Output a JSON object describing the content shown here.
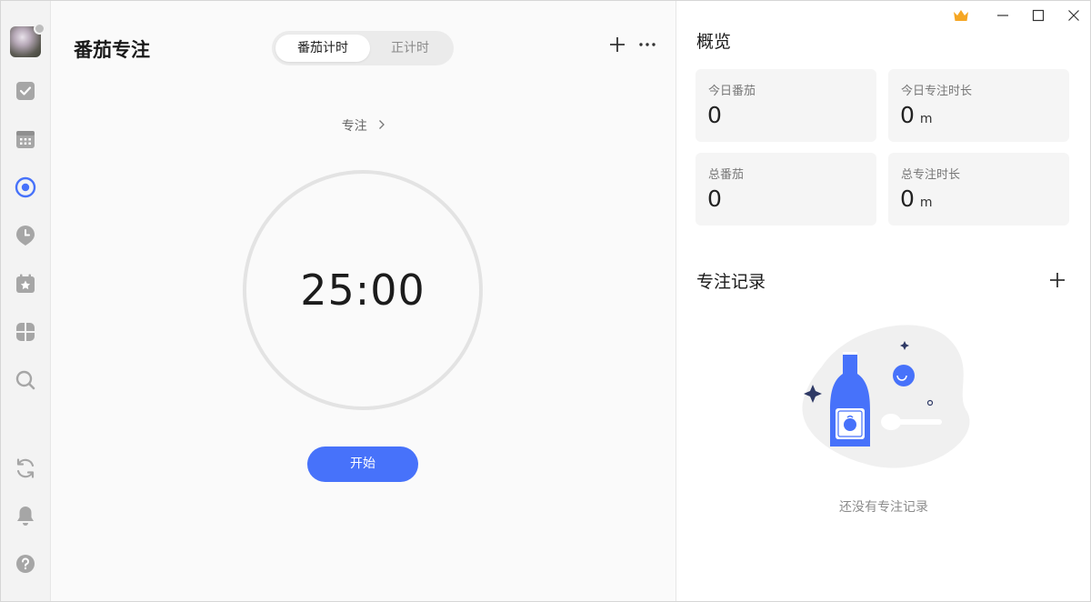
{
  "sidebar": {
    "icons": [
      "avatar",
      "task-check-icon",
      "calendar-icon",
      "pomodoro-icon",
      "habit-icon",
      "countdown-icon",
      "matrix-icon",
      "search-icon",
      "sync-icon",
      "bell-icon",
      "help-icon"
    ]
  },
  "main": {
    "title": "番茄专注",
    "tabs": [
      "番茄计时",
      "正计时"
    ],
    "active_tab": 0,
    "focus_label": "专注",
    "timer": "25:00",
    "start_label": "开始"
  },
  "overview": {
    "title": "概览",
    "stats": [
      {
        "label": "今日番茄",
        "value": "0",
        "unit": ""
      },
      {
        "label": "今日专注时长",
        "value": "0",
        "unit": "m"
      },
      {
        "label": "总番茄",
        "value": "0",
        "unit": ""
      },
      {
        "label": "总专注时长",
        "value": "0",
        "unit": "m"
      }
    ]
  },
  "records": {
    "title": "专注记录",
    "empty_text": "还没有专注记录"
  },
  "colors": {
    "accent": "#4772fa",
    "active_nav": "#4772fa",
    "icon_gray": "#a6a6a6",
    "crown": "#f5a623"
  }
}
